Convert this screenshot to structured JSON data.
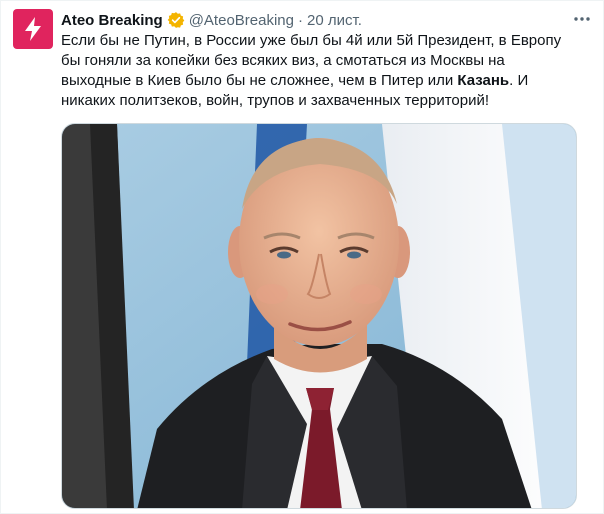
{
  "account": {
    "name": "Ateo Breaking",
    "handle": "@AteoBreaking",
    "separator": "·",
    "time": "20 лист.",
    "avatar_icon": "lightning-bolt-icon",
    "verified_icon": "verified-badge-icon",
    "brand_color": "#e0245e",
    "verified_color": "#f4b400"
  },
  "tweet": {
    "text_part1": "Если бы не Путин, в России уже был бы 4й или 5й Президент, в Европу бы гоняли за копейки без всяких виз, а смотаться из Москвы на выходные в Киев было бы не сложнее, чем в Питер или ",
    "text_bold": "Казань",
    "text_part2": ". И никаких политзеков, войн, трупов и захваченных территорий!"
  },
  "more_icon": "more-options-icon",
  "media": {
    "type": "photo",
    "icon": "photo-icon"
  }
}
